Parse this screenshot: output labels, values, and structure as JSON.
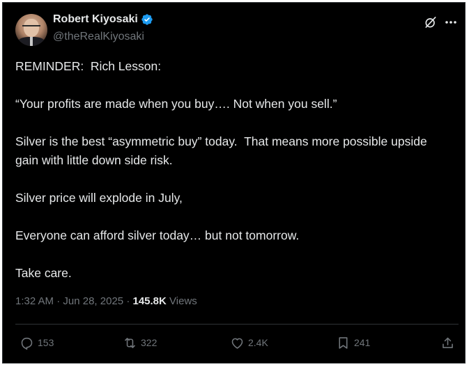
{
  "author": {
    "display_name": "Robert Kiyosaki",
    "handle": "@theRealKiyosaki",
    "verified": true
  },
  "post": {
    "paragraphs": [
      "REMINDER:  Rich Lesson:",
      "“Your profits are made when you buy…. Not when you sell.”",
      "Silver is the best “asymmetric buy” today.  That means more possible upside gain with little down side risk.",
      "Silver price will explode in July,",
      "Everyone can afford silver today… but not tomorrow.",
      "Take care."
    ],
    "time": "1:32 AM",
    "separator": "·",
    "date": "Jun 28, 2025",
    "views_count": "145.8K",
    "views_label": "Views"
  },
  "actions": {
    "replies": "153",
    "reposts": "322",
    "likes": "2.4K",
    "bookmarks": "241"
  },
  "colors": {
    "background": "#000000",
    "text_primary": "#e7e9ea",
    "text_secondary": "#71767b",
    "verified_blue": "#1d9bf0",
    "divider": "#2f3336"
  },
  "icons": {
    "verified": "verified-badge-icon",
    "grok": "grok-icon",
    "more": "more-options-icon",
    "reply": "reply-icon",
    "repost": "repost-icon",
    "like": "heart-icon",
    "bookmark": "bookmark-icon",
    "share": "share-icon"
  }
}
